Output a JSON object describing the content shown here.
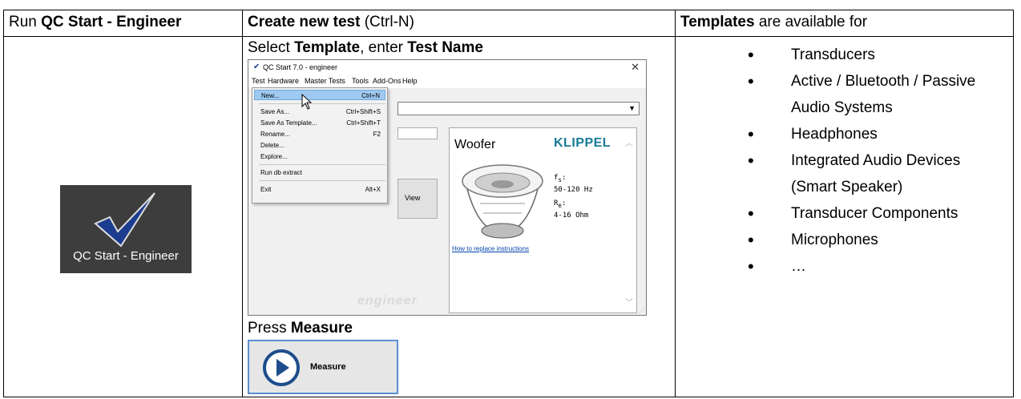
{
  "headers": {
    "col1_prefix": "Run ",
    "col1_bold": "QC Start - Engineer",
    "col2_bold": "Create new test",
    "col2_suffix": " (Ctrl-N)",
    "col3_bold": "Templates",
    "col3_suffix": " are available for"
  },
  "desktop_icon": {
    "label": "QC Start - Engineer",
    "bg_color": "#3d3d3d",
    "check_color": "#1c3d8f"
  },
  "step1": {
    "prefix": "Select ",
    "bold1": "Template",
    "middle": ", enter ",
    "bold2": "Test Name"
  },
  "app_window": {
    "title": "QC Start  7.0 - engineer",
    "menu": [
      "Test",
      "Hardware",
      "Master Tests",
      "Tools",
      "Add-Ons",
      "Help"
    ],
    "dropdown_items": [
      {
        "label": "New...",
        "shortcut": "Ctrl+N"
      },
      {
        "label": "Save As...",
        "shortcut": "Ctrl+Shift+S"
      },
      {
        "label": "Save As Template...",
        "shortcut": "Ctrl+Shift+T"
      },
      {
        "label": "Rename...",
        "shortcut": "F2"
      },
      {
        "label": "Delete...",
        "shortcut": ""
      },
      {
        "label": "Explore...",
        "shortcut": ""
      },
      {
        "label": "Run db extract",
        "shortcut": ""
      },
      {
        "label": "Exit",
        "shortcut": "Alt+X"
      }
    ],
    "view_button": "View",
    "template_name": "Woofer",
    "brand": "KLIPPEL",
    "fs_label": "f",
    "fs_sub": "s",
    "fs_value": "50-120 Hz",
    "re_label": "R",
    "re_sub": "e",
    "re_value": "4-16 Ohm",
    "link": "How to replace instructions",
    "edition": "engineer"
  },
  "step2": {
    "prefix": "Press ",
    "bold": "Measure"
  },
  "measure_button": {
    "label": "Measure",
    "accent": "#1e4d8c"
  },
  "templates": [
    "Transducers",
    "Active / Bluetooth / Passive Audio Systems",
    "Headphones",
    "Integrated Audio Devices (Smart Speaker)",
    "Transducer Components",
    "Microphones",
    "…"
  ]
}
